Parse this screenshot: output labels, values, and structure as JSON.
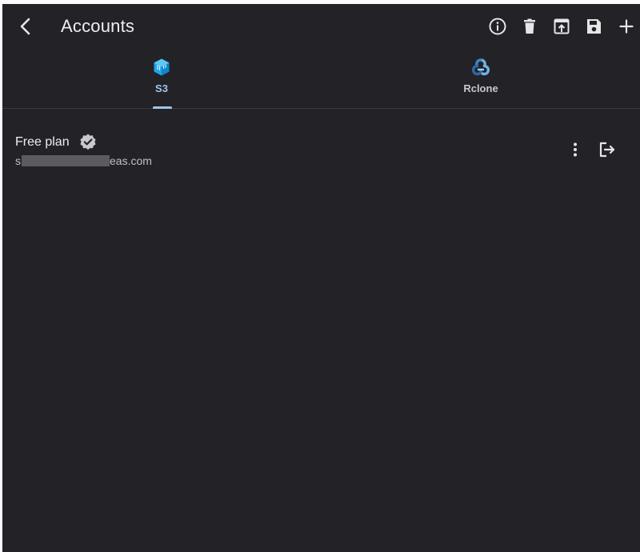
{
  "header": {
    "title": "Accounts",
    "back_icon": "chevron-left-icon",
    "actions": [
      {
        "name": "info-icon"
      },
      {
        "name": "delete-icon"
      },
      {
        "name": "open-in-new-icon"
      },
      {
        "name": "save-icon"
      },
      {
        "name": "add-icon"
      }
    ]
  },
  "tabs": [
    {
      "label": "S3",
      "icon": "s3-cube-icon",
      "selected": true
    },
    {
      "label": "Rclone",
      "icon": "rclone-icon",
      "selected": false
    }
  ],
  "account": {
    "plan": "Free plan",
    "email_first_char": "s",
    "email_suffix": "eas.com",
    "verified_icon": "verified-badge-icon"
  },
  "colors": {
    "background": "#232227",
    "accent": "#9ec6ee",
    "s3_icon": "#1fa6e8",
    "rclone_icon": "#6fb3e0"
  }
}
